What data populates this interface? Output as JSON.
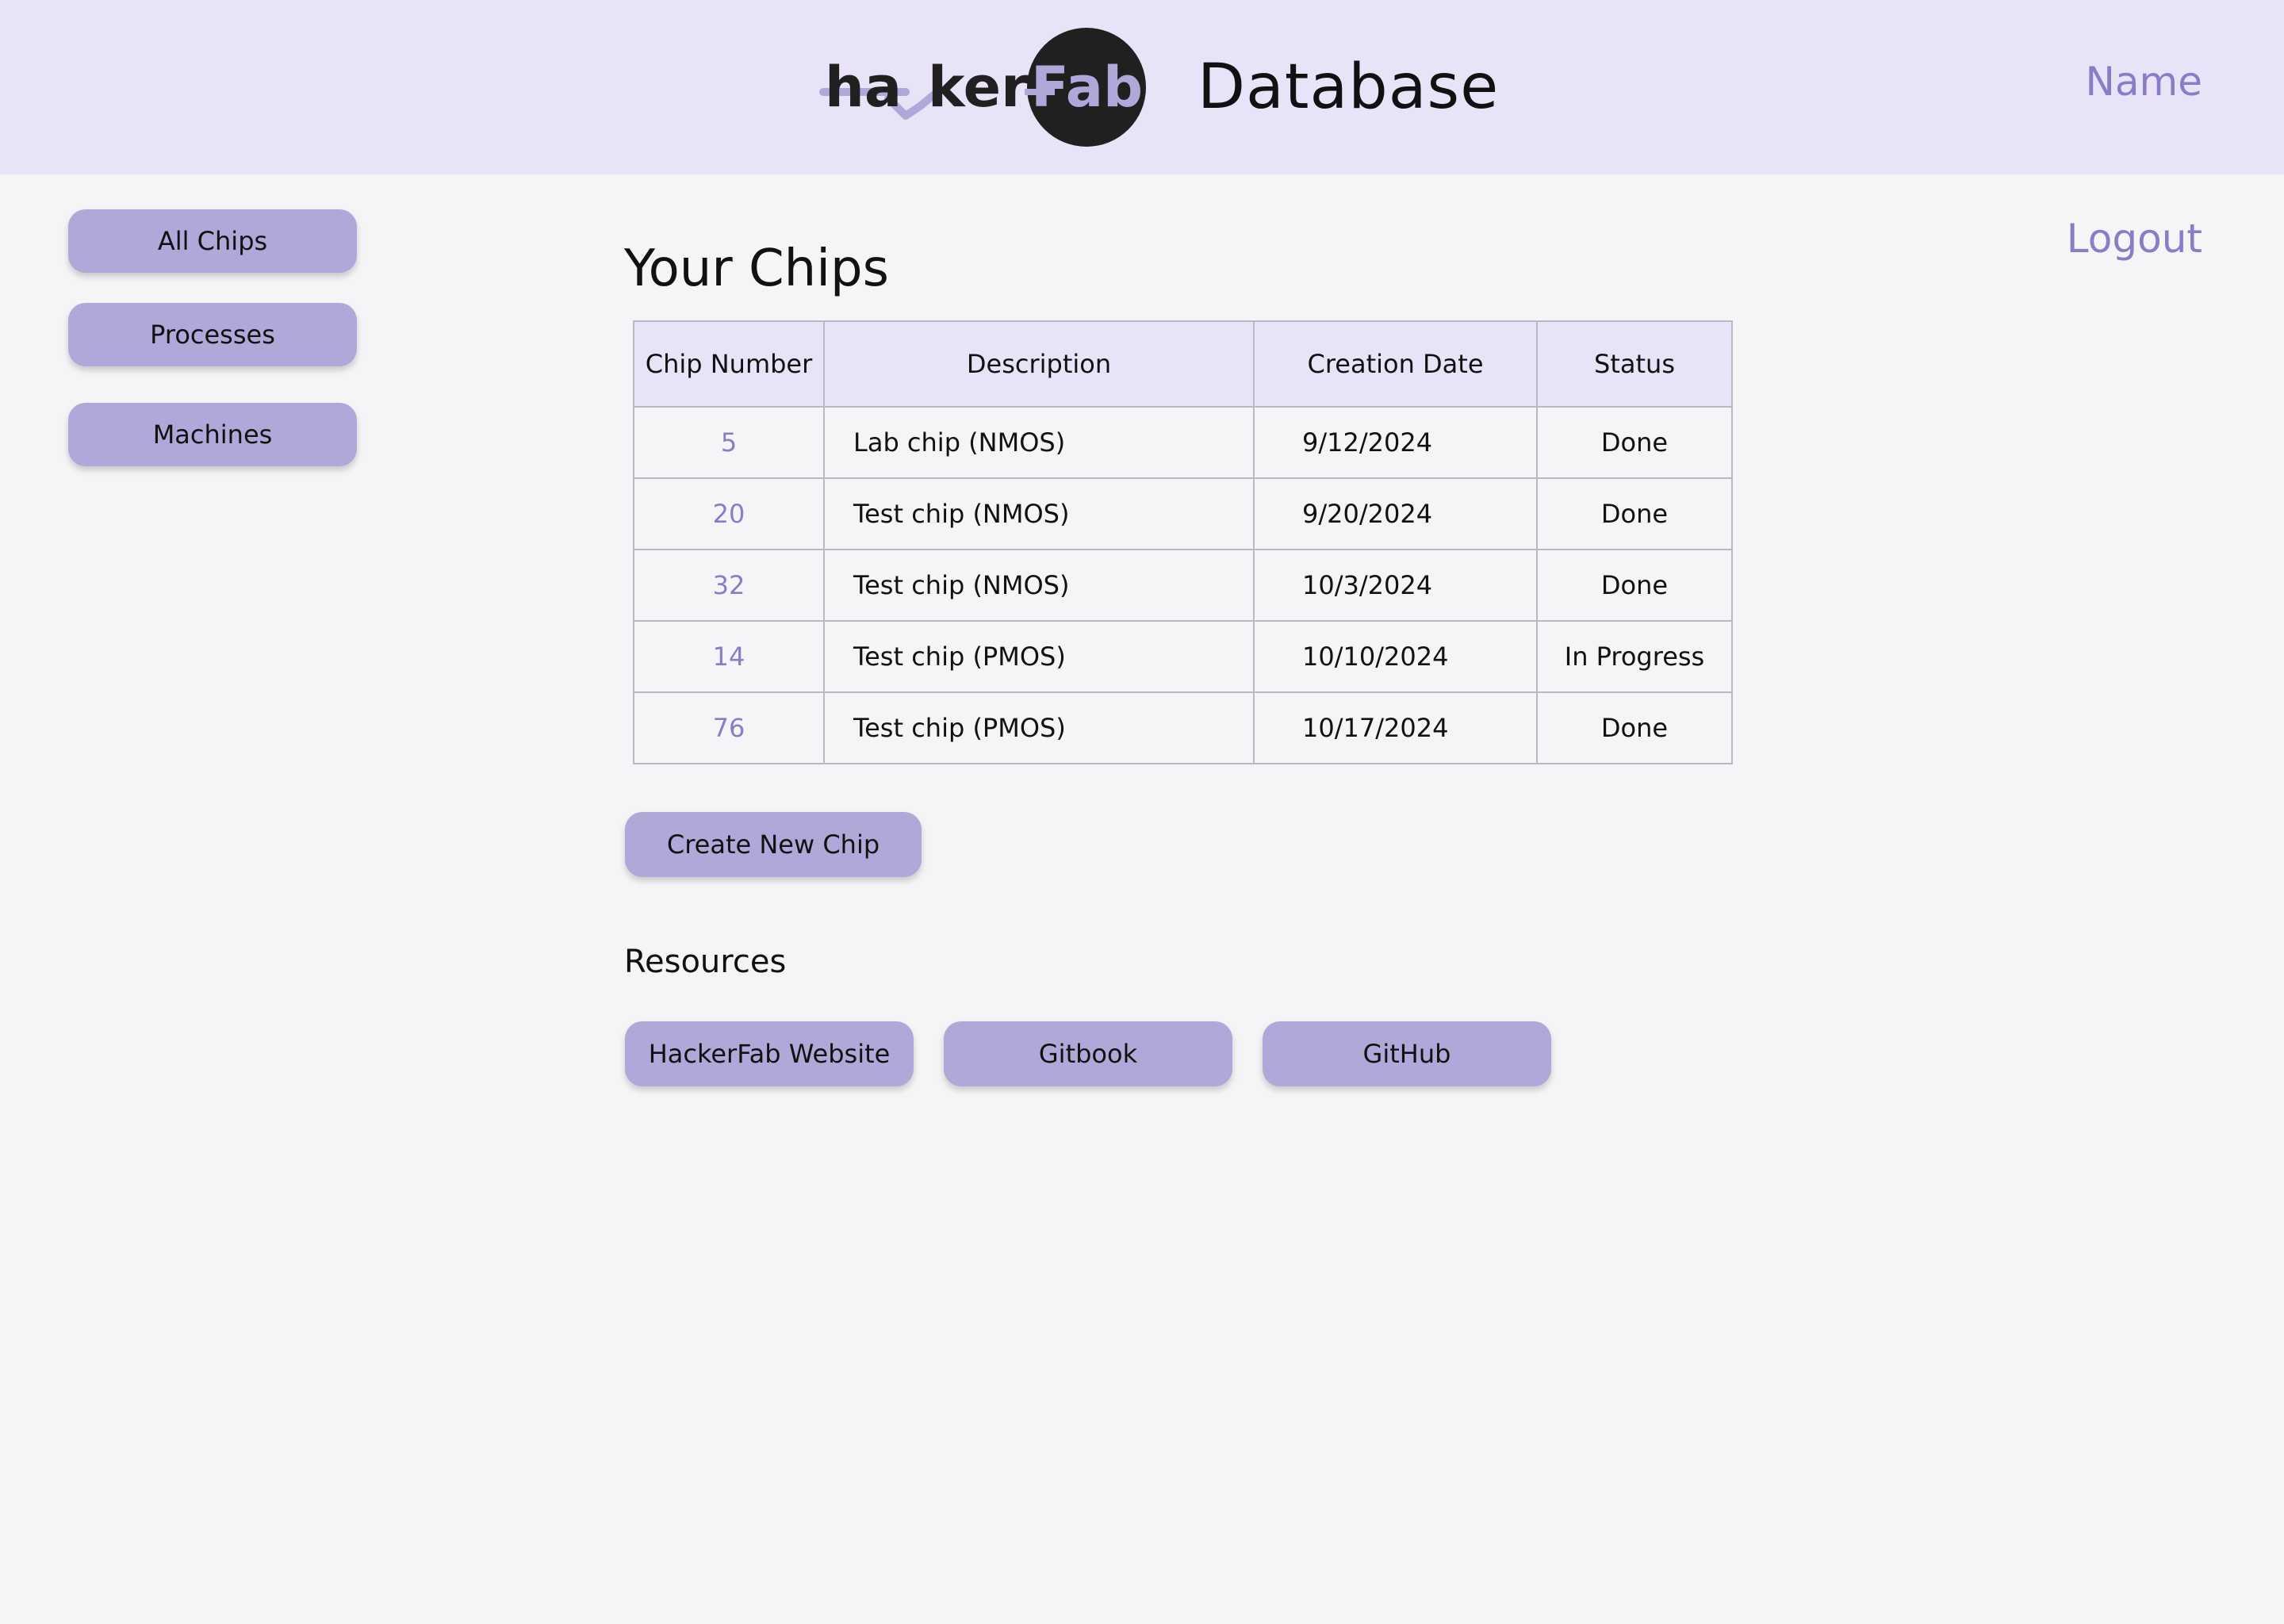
{
  "header": {
    "logo_text": "hackerFab",
    "title": "Database",
    "name_link": "Name",
    "logout_link": "Logout"
  },
  "sidebar": {
    "items": [
      {
        "label": "All Chips"
      },
      {
        "label": "Processes"
      },
      {
        "label": "Machines"
      }
    ]
  },
  "main": {
    "title": "Your Chips",
    "table": {
      "columns": [
        "Chip Number",
        "Description",
        "Creation Date",
        "Status"
      ],
      "rows": [
        {
          "chip_number": "5",
          "description": "Lab chip (NMOS)",
          "creation_date": "9/12/2024",
          "status": "Done"
        },
        {
          "chip_number": "20",
          "description": "Test chip (NMOS)",
          "creation_date": "9/20/2024",
          "status": "Done"
        },
        {
          "chip_number": "32",
          "description": "Test chip (NMOS)",
          "creation_date": "10/3/2024",
          "status": "Done"
        },
        {
          "chip_number": "14",
          "description": "Test chip (PMOS)",
          "creation_date": "10/10/2024",
          "status": "In Progress"
        },
        {
          "chip_number": "76",
          "description": "Test chip (PMOS)",
          "creation_date": "10/17/2024",
          "status": "Done"
        }
      ]
    },
    "create_button": "Create New Chip",
    "resources": {
      "title": "Resources",
      "links": [
        {
          "label": "HackerFab Website"
        },
        {
          "label": "Gitbook"
        },
        {
          "label": "GitHub"
        }
      ]
    }
  },
  "colors": {
    "header_bg": "#e9e3f8",
    "page_bg": "#f5f5f7",
    "button_bg": "#b1a7d8",
    "accent_text": "#8a7cc6",
    "logo_circle": "#221f20"
  }
}
